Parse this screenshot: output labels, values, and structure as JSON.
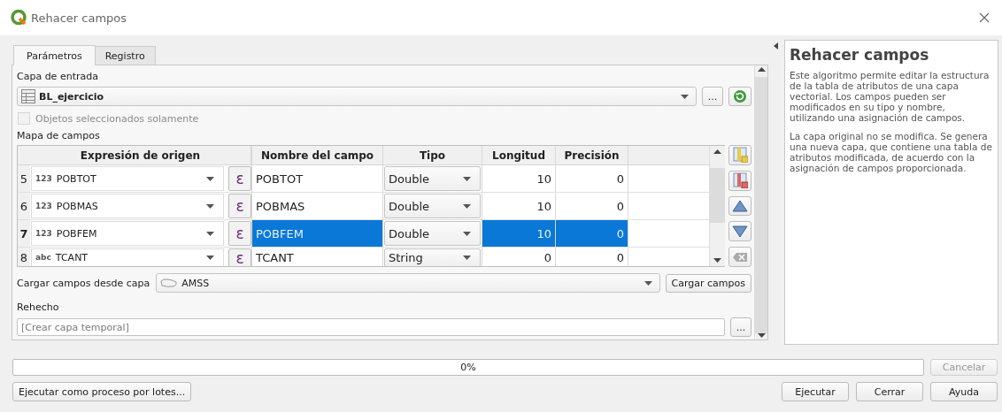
{
  "window": {
    "title": "Rehacer campos"
  },
  "tabs": [
    {
      "label": "Parámetros",
      "selected": true
    },
    {
      "label": "Registro",
      "selected": false
    }
  ],
  "input_layer": {
    "label": "Capa de entrada",
    "value": "BL_ejercicio",
    "browse_button": "..."
  },
  "selected_only": {
    "label": "Objetos seleccionados solamente",
    "checked": false,
    "disabled": true
  },
  "field_map": {
    "label": "Mapa de campos",
    "columns": [
      "Expresión de origen",
      "Nombre del campo",
      "Tipo",
      "Longitud",
      "Precisión"
    ],
    "rows": [
      {
        "number": "5",
        "source_type": "123",
        "source": "POBTOT",
        "expression_button": "ε",
        "name": "POBTOT",
        "type": "Double",
        "length": "10",
        "precision": "0",
        "selected": false
      },
      {
        "number": "6",
        "source_type": "123",
        "source": "POBMAS",
        "expression_button": "ε",
        "name": "POBMAS",
        "type": "Double",
        "length": "10",
        "precision": "0",
        "selected": false
      },
      {
        "number": "7",
        "source_type": "123",
        "source": "POBFEM",
        "expression_button": "ε",
        "name": "POBFEM",
        "type": "Double",
        "length": "10",
        "precision": "0",
        "selected": true
      },
      {
        "number": "8",
        "source_type": "abc",
        "source": "TCANT",
        "expression_button": "ε",
        "name": "TCANT",
        "type": "String",
        "length": "0",
        "precision": "0",
        "selected": false
      }
    ]
  },
  "load_fields": {
    "label": "Cargar campos desde capa",
    "layer": "AMSS",
    "button": "Cargar campos"
  },
  "output": {
    "label": "Rehecho",
    "placeholder": "[Crear capa temporal]",
    "browse_button": "..."
  },
  "help": {
    "title": "Rehacer campos",
    "paragraphs": [
      "Este algoritmo permite editar la estructura de la tabla de atributos de una capa vectorial. Los campos pueden ser modificados en su tipo y nombre, utilizando una asignación de campos.",
      "La capa original no se modifica. Se genera una nueva capa, que contiene una tabla de atributos modificada, de acuerdo con la asignación de campos proporcionada."
    ]
  },
  "progress": {
    "level": 0,
    "text": "0%"
  },
  "cancel_button": {
    "label": "Cancelar",
    "disabled": true
  },
  "batch_button": "Ejecutar como proceso por lotes...",
  "buttons": [
    "Ejecutar",
    "Cerrar",
    "Ayuda"
  ]
}
